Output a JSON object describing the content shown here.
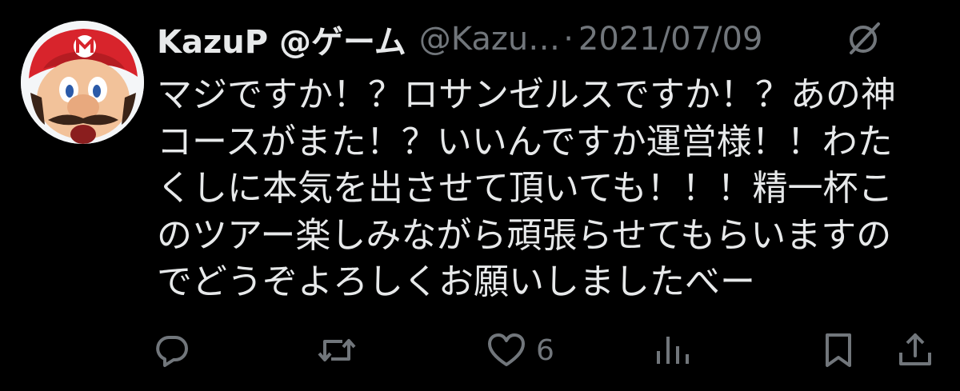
{
  "tweet": {
    "display_name": "KazuP @ゲーム",
    "handle": "@Kazu…",
    "separator": "·",
    "date": "2021/07/09",
    "text_lines": [
      "マジですか！？ロサンゼルスですか！？あの神",
      "コースがまた！？いいんですか運営様！！わた",
      "くしに本気を出させて頂いても！！！精一杯こ",
      "のツアー楽しみながら頑張らせてもらいますの",
      "でどうぞよろしくお願いしましたべー"
    ]
  },
  "actions": {
    "reply_icon": "reply-icon",
    "retweet_icon": "retweet-icon",
    "like_icon": "heart-icon",
    "like_count": "6",
    "views_icon": "views-icon",
    "bookmark_icon": "bookmark-icon",
    "share_icon": "share-icon"
  },
  "colors": {
    "background": "#000000",
    "text_primary": "#e7e9ea",
    "text_secondary": "#71767b"
  }
}
